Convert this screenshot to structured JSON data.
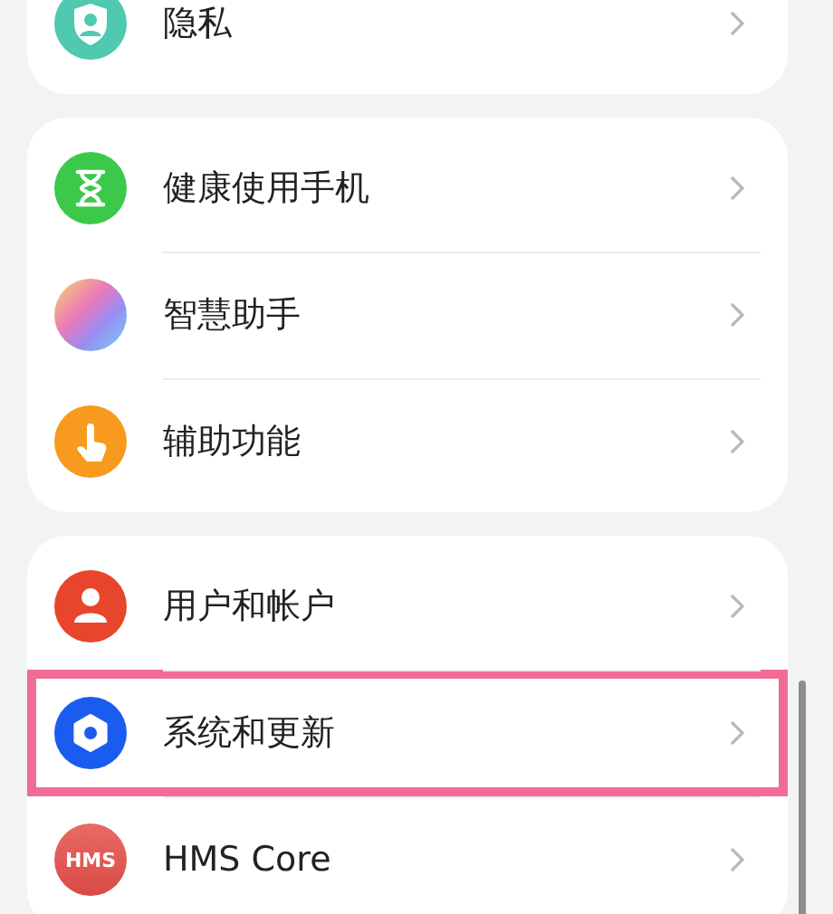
{
  "groups": [
    {
      "items": [
        {
          "kind": "shield",
          "label": "隐私",
          "highlighted": false
        }
      ]
    },
    {
      "items": [
        {
          "kind": "hourglass",
          "label": "健康使用手机",
          "highlighted": false
        },
        {
          "kind": "orb",
          "label": "智慧助手",
          "highlighted": false
        },
        {
          "kind": "hand",
          "label": "辅助功能",
          "highlighted": false
        }
      ]
    },
    {
      "items": [
        {
          "kind": "person",
          "label": "用户和帐户",
          "highlighted": false
        },
        {
          "kind": "gear",
          "label": "系统和更新",
          "highlighted": true
        },
        {
          "kind": "text",
          "icon_text": "HMS",
          "label": "HMS Core",
          "highlighted": false
        }
      ]
    }
  ]
}
